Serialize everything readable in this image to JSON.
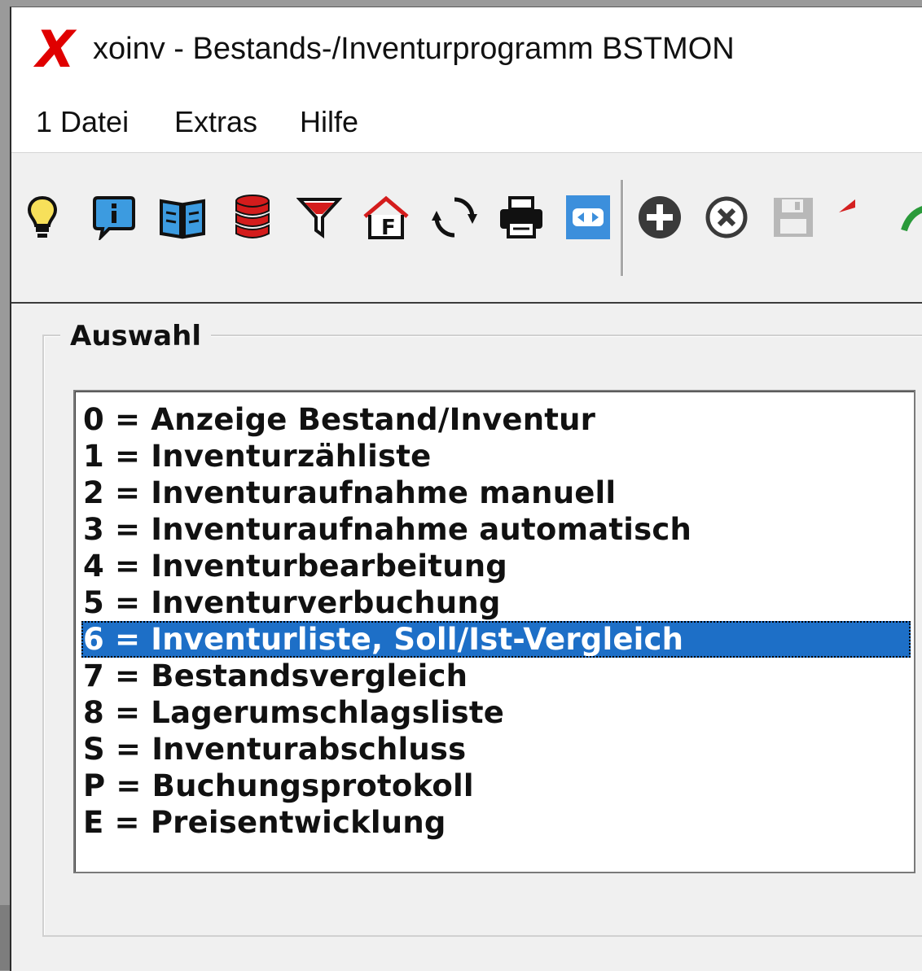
{
  "window": {
    "title": "xoinv - Bestands-/Inventurprogramm BSTMON",
    "logo": "X"
  },
  "menu": {
    "items": [
      {
        "label": "1 Datei"
      },
      {
        "label": "Extras"
      },
      {
        "label": "Hilfe"
      }
    ]
  },
  "toolbar": {
    "icons": [
      "lightbulb-icon",
      "info-icon",
      "book-icon",
      "database-icon",
      "filter-icon",
      "home-f-icon",
      "refresh-icon",
      "printer-icon",
      "resize-icon",
      "add-icon",
      "cancel-icon",
      "save-icon",
      "undo-icon",
      "redo-icon"
    ],
    "colors": {
      "database": "#d41c1c",
      "undo": "#d42020",
      "redo": "#2a9a3a",
      "info": "#1e5f9e",
      "resize_bg": "#3c8fdc"
    }
  },
  "group": {
    "title": "Auswahl"
  },
  "list": {
    "items": [
      {
        "label": "0 = Anzeige Bestand/Inventur"
      },
      {
        "label": "1 = Inventurzähliste"
      },
      {
        "label": "2 = Inventuraufnahme manuell"
      },
      {
        "label": "3 = Inventuraufnahme automatisch"
      },
      {
        "label": "4 = Inventurbearbeitung"
      },
      {
        "label": "5 = Inventurverbuchung"
      },
      {
        "label": "6 = Inventurliste, Soll/Ist-Vergleich"
      },
      {
        "label": "7 = Bestandsvergleich"
      },
      {
        "label": "8 = Lagerumschlagsliste"
      },
      {
        "label": "S = Inventurabschluss"
      },
      {
        "label": "P = Buchungsprotokoll"
      },
      {
        "label": "E = Preisentwicklung"
      }
    ],
    "selected_index": 6,
    "selection_color": "#1d6fc7"
  }
}
